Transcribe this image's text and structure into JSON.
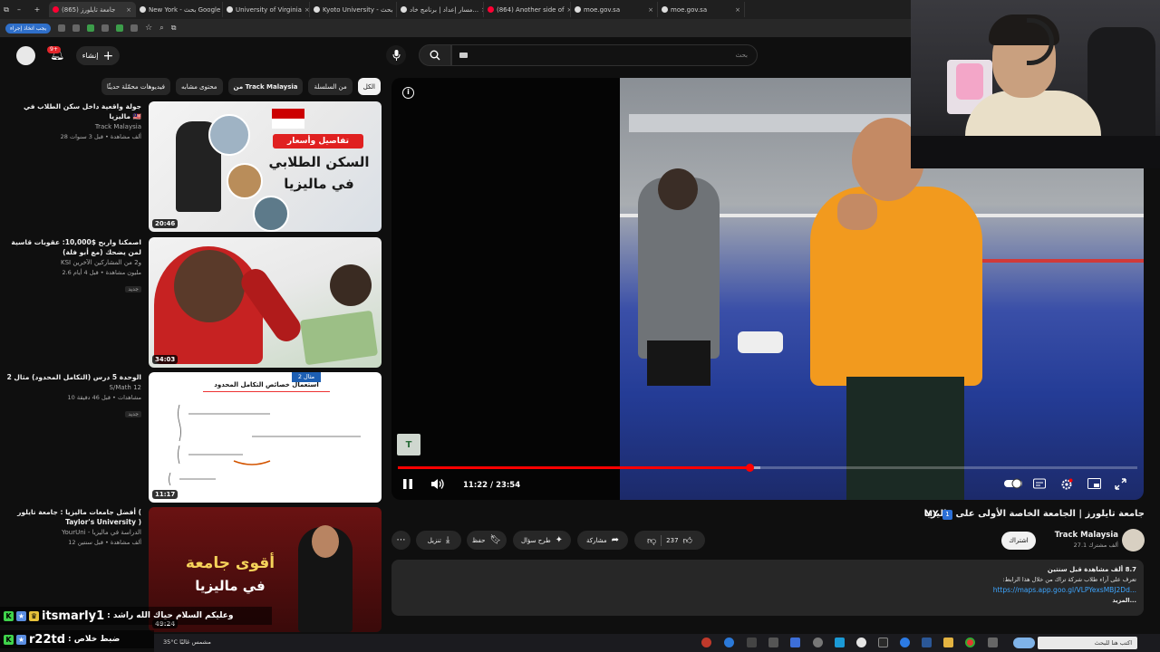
{
  "browser": {
    "tabs": [
      {
        "label": "جامعة تايلورز (865)",
        "icon": "youtube-icon"
      },
      {
        "label": "New York - بحث Google",
        "icon": "google-icon"
      },
      {
        "label": "University of Virginia",
        "icon": "globe-icon"
      },
      {
        "label": "Kyoto University - بحث",
        "icon": "google-icon"
      },
      {
        "label": "مسار إعداد | برنامج خاد...",
        "icon": "globe-icon"
      },
      {
        "label": "(864) Another side of",
        "icon": "youtube-icon"
      },
      {
        "label": "moe.gov.sa",
        "icon": "globe-icon"
      },
      {
        "label": "moe.gov.sa",
        "icon": "globe-icon"
      }
    ],
    "toolbar_pill": "يجب اتخاذ إجراء"
  },
  "masthead": {
    "notifications_count": "9+",
    "create_label": "إنشاء",
    "search_placeholder": "بحث"
  },
  "chips": [
    {
      "label": "الكل",
      "selected": true
    },
    {
      "label": "من السلسلة",
      "selected": false
    },
    {
      "label": "من Track Malaysia",
      "selected": false
    },
    {
      "label": "محتوى مشابه",
      "selected": false
    },
    {
      "label": "فيديوهات محمّلة حديثًا",
      "selected": false
    }
  ],
  "recommendations": [
    {
      "title": "جولة واقعية داخل سكن الطلاب في ماليزيا 🇲🇾",
      "channel": "Track Malaysia",
      "views": "28 ألف مشاهدة • قبل 3 سنوات",
      "duration": "20:46",
      "badge": "",
      "thumb_text": [
        "تفاصيل وأسعار",
        "السكن الطلابي",
        "في ماليزيا"
      ]
    },
    {
      "title": "اصمكنا واربح $10,000: عقوبات قاسية لمن يضحك (مع أبو فلة)",
      "channel": "KSI و2 من المشاركين الآخرين",
      "views": "2.6 مليون مشاهدة • قبل 4 أيام",
      "duration": "34:03",
      "badge": "جديد",
      "thumb_text": []
    },
    {
      "title": "الوحدة 5 درس (التكامل المحدود) مثال 2",
      "channel": "S/Math 12",
      "views": "10 مشاهدات • قبل 46 دقيقة",
      "duration": "11:17",
      "badge": "جديد",
      "thumb_text": [
        "استعمال خصائص التكامل المحدود",
        "مثال 2"
      ]
    },
    {
      "title": "أفضل جامعات ماليزيا : جامعة تايلور ( Taylor's University )",
      "channel": "YourUni - الدراسة في ماليزيا",
      "views": "12 ألف مشاهدة • قبل سنتين",
      "duration": "49:24",
      "badge": "",
      "thumb_text": [
        "أقوى جامعة",
        "في ماليزيا"
      ]
    }
  ],
  "player": {
    "time_current": "11:22",
    "time_total": "23:54",
    "time_display": "11:22 / 23:54",
    "progress_played": 0.4756,
    "progress_buffered": 0.49
  },
  "video": {
    "title": "جامعة تايلورز | الجامعة الخاصة الأولى على ماليزيا",
    "title_flag": "1",
    "title_suffix": "MY",
    "channel_name": "Track Malaysia",
    "channel_subs": "27.1 ألف مشترك",
    "subscribe_label": "اشتراك",
    "likes": "237",
    "actions": {
      "share": "مشاركة",
      "ask": "طرح سؤال",
      "save": "حفظ",
      "download": "تنزيل"
    }
  },
  "description": {
    "stats": "8.7 ألف مشاهدة  قبل سنتين",
    "text": "تعرف على آراء طلاب شركة تراك من خلال هذا الرابط:",
    "link": "https://maps.app.goo.gl/VLPYexsMBJ2Dd...",
    "more": "...المزيد"
  },
  "stream_chat": [
    {
      "name": "itsmarly1",
      "message": ": وعليكم السلام حياك الله راشد"
    },
    {
      "name": "r22td",
      "message": ": ضبط خلاص"
    }
  ],
  "taskbar": {
    "weather": "35°C  مشمس غالبًا",
    "search_placeholder": "اكتب هنا للبحث"
  },
  "colors": {
    "youtube_red": "#ff0000",
    "link_blue": "#3ea6ff",
    "background": "#0f0f0f"
  }
}
